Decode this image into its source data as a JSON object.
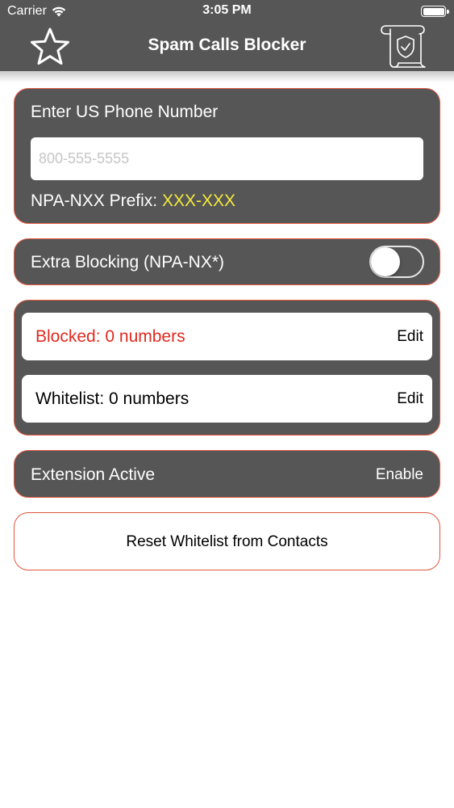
{
  "status_bar": {
    "carrier": "Carrier",
    "time": "3:05 PM",
    "wifi_icon": "wifi-icon",
    "battery_icon": "battery-icon"
  },
  "nav": {
    "title": "Spam Calls Blocker",
    "left_icon": "star-icon",
    "right_icon": "shield-scroll-icon"
  },
  "phone_card": {
    "label": "Enter US Phone Number",
    "input_value": "",
    "input_placeholder": "800-555-5555",
    "prefix_label": "NPA-NXX Prefix: ",
    "prefix_value": "XXX-XXX"
  },
  "extra_blocking": {
    "label": "Extra Blocking (NPA-NX*)",
    "toggle_on": false
  },
  "lists": {
    "blocked_label": "Blocked: 0 numbers",
    "blocked_edit": "Edit",
    "whitelist_label": "Whitelist: 0 numbers",
    "whitelist_edit": "Edit"
  },
  "extension": {
    "label": "Extension Active",
    "action": "Enable"
  },
  "reset_button": {
    "label": "Reset Whitelist from Contacts"
  },
  "colors": {
    "bar_background": "#565656",
    "card_border": "#e0573e",
    "prefix_yellow": "#f4ea3c",
    "blocked_red": "#e02a20"
  }
}
